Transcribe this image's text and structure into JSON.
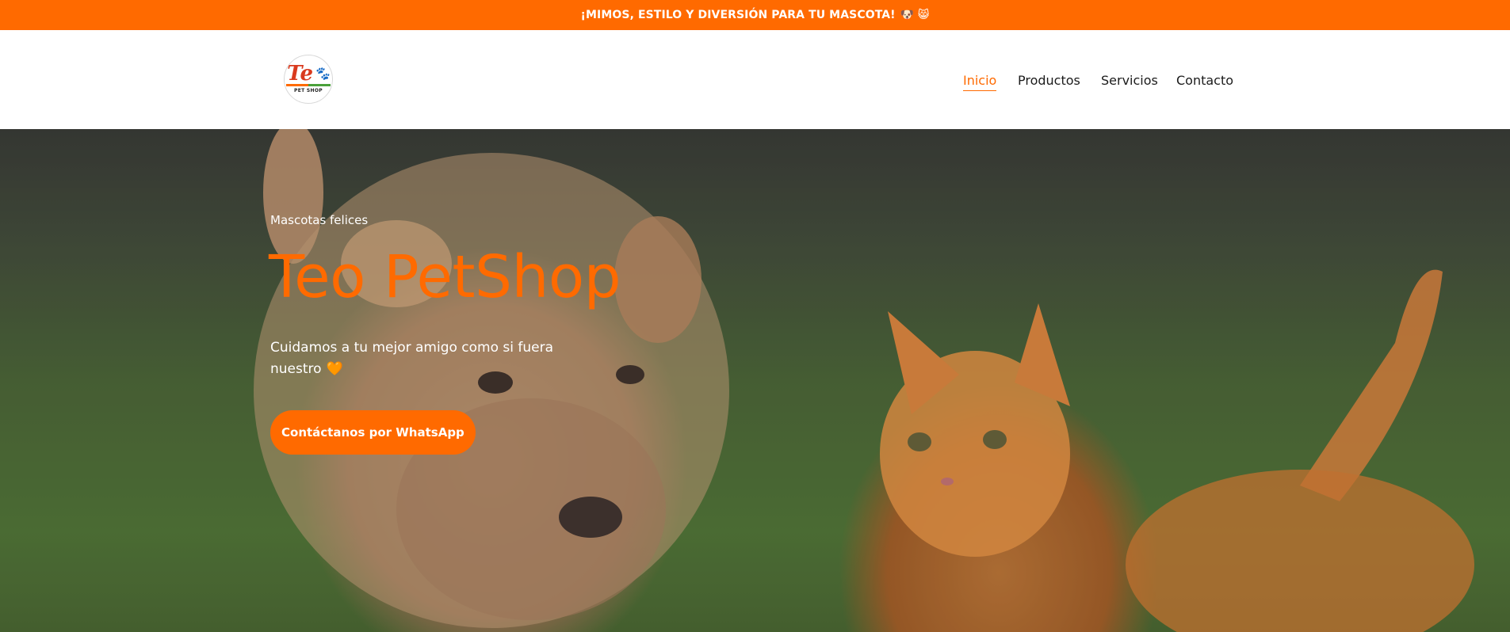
{
  "announcement": {
    "text": "¡MIMOS, ESTILO Y DIVERSIÓN PARA TU MASCOTA!",
    "emojis": "🐶 😸"
  },
  "header": {
    "logo": {
      "mark": "Te",
      "paw": "🐾",
      "subtext": "PET SHOP"
    },
    "nav": [
      {
        "label": "Inicio",
        "active": true
      },
      {
        "label": "Productos",
        "active": false
      },
      {
        "label": "Servicios",
        "active": false
      },
      {
        "label": "Contacto",
        "active": false
      }
    ]
  },
  "hero": {
    "eyebrow": "Mascotas felices",
    "title": "Teo PetShop",
    "subtitle": "Cuidamos a tu mejor amigo como si fuera nuestro",
    "heart": "🧡",
    "cta_label": "Contáctanos por WhatsApp"
  },
  "colors": {
    "accent": "#ff6a00",
    "header_bg": "#ffffff",
    "text_dark": "#1b1b1b",
    "text_light": "#ffffff"
  }
}
